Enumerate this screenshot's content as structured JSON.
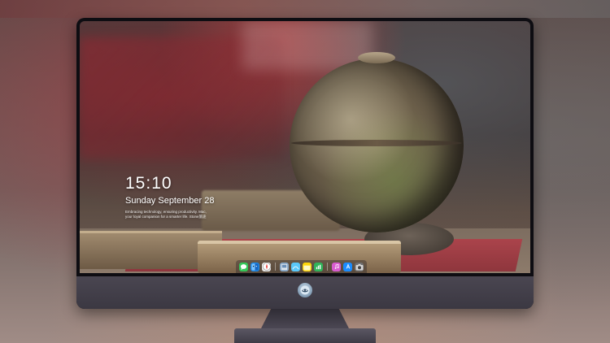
{
  "lock_screen": {
    "time": "15:10",
    "date": "Sunday September 28",
    "caption_line1": "Embracing technology, ensuring productivity. Mac,",
    "caption_line2": "your loyal companion for a smarter life. Stone旅途"
  },
  "dock": {
    "items": [
      {
        "name": "messages",
        "icon": "messages-icon",
        "color": "#34c759"
      },
      {
        "name": "finder",
        "icon": "finder-icon",
        "color": "#1e88e5"
      },
      {
        "name": "safari",
        "icon": "safari-icon",
        "color": "#e9e9e9"
      },
      {
        "name": "preview",
        "icon": "preview-icon",
        "color": "#8aa9c9"
      },
      {
        "name": "launchpad",
        "icon": "launchpad-icon",
        "color": "#5ac8fa"
      },
      {
        "name": "notes",
        "icon": "notes-icon",
        "color": "#ffd60a"
      },
      {
        "name": "numbers",
        "icon": "numbers-icon",
        "color": "#30b45a"
      },
      {
        "name": "itunes",
        "icon": "itunes-icon",
        "color": "#d85cd0"
      },
      {
        "name": "app-store",
        "icon": "app-store-icon",
        "color": "#1a8cff"
      },
      {
        "name": "camera",
        "icon": "camera-icon",
        "color": "#6d6d6d"
      }
    ]
  },
  "colors": {
    "bezel": "#0e0d12",
    "chin": "#4a4651",
    "text": "#ffffff"
  }
}
